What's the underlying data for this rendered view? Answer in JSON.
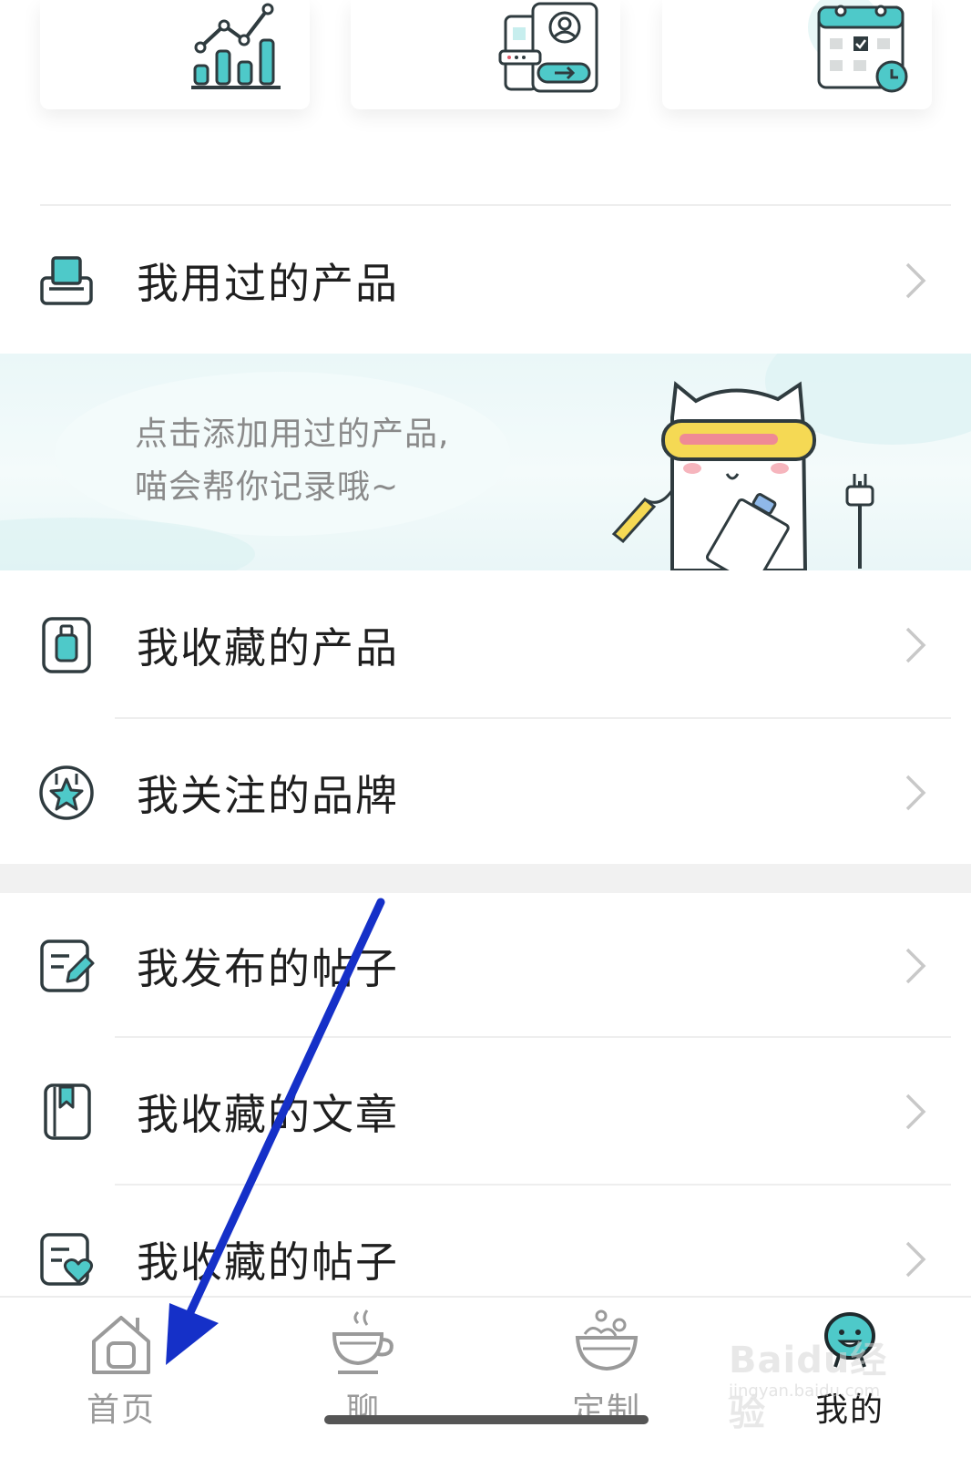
{
  "shortcut_cards": [
    {
      "icon": "chart-stats-icon"
    },
    {
      "icon": "profile-card-icon"
    },
    {
      "icon": "calendar-icon"
    }
  ],
  "menu_group_1": [
    {
      "label": "我用过的产品",
      "icon": "product-box-icon"
    }
  ],
  "banner": {
    "line1": "点击添加用过的产品,",
    "line2": "喵会帮你记录哦~",
    "illustration": "cat-mascot-illustration"
  },
  "menu_group_2": [
    {
      "label": "我收藏的产品",
      "icon": "bottle-icon"
    },
    {
      "label": "我关注的品牌",
      "icon": "star-badge-icon"
    }
  ],
  "menu_group_3": [
    {
      "label": "我发布的帖子",
      "icon": "edit-post-icon"
    },
    {
      "label": "我收藏的文章",
      "icon": "bookmark-article-icon"
    },
    {
      "label": "我收藏的帖子",
      "icon": "heart-post-icon"
    }
  ],
  "tabs": [
    {
      "label": "首页",
      "icon": "home-icon",
      "active": false
    },
    {
      "label": "聊",
      "icon": "coffee-cup-icon",
      "active": false
    },
    {
      "label": "定制",
      "icon": "bowl-icon",
      "active": false
    },
    {
      "label": "我的",
      "icon": "face-avatar-icon",
      "active": true
    }
  ],
  "watermark": {
    "main": "Baidu经验",
    "sub": "jingyan.baidu.com"
  },
  "colors": {
    "accent": "#4ec9c9",
    "icon_stroke": "#2f3b3f",
    "arrow": "#1530c8"
  }
}
